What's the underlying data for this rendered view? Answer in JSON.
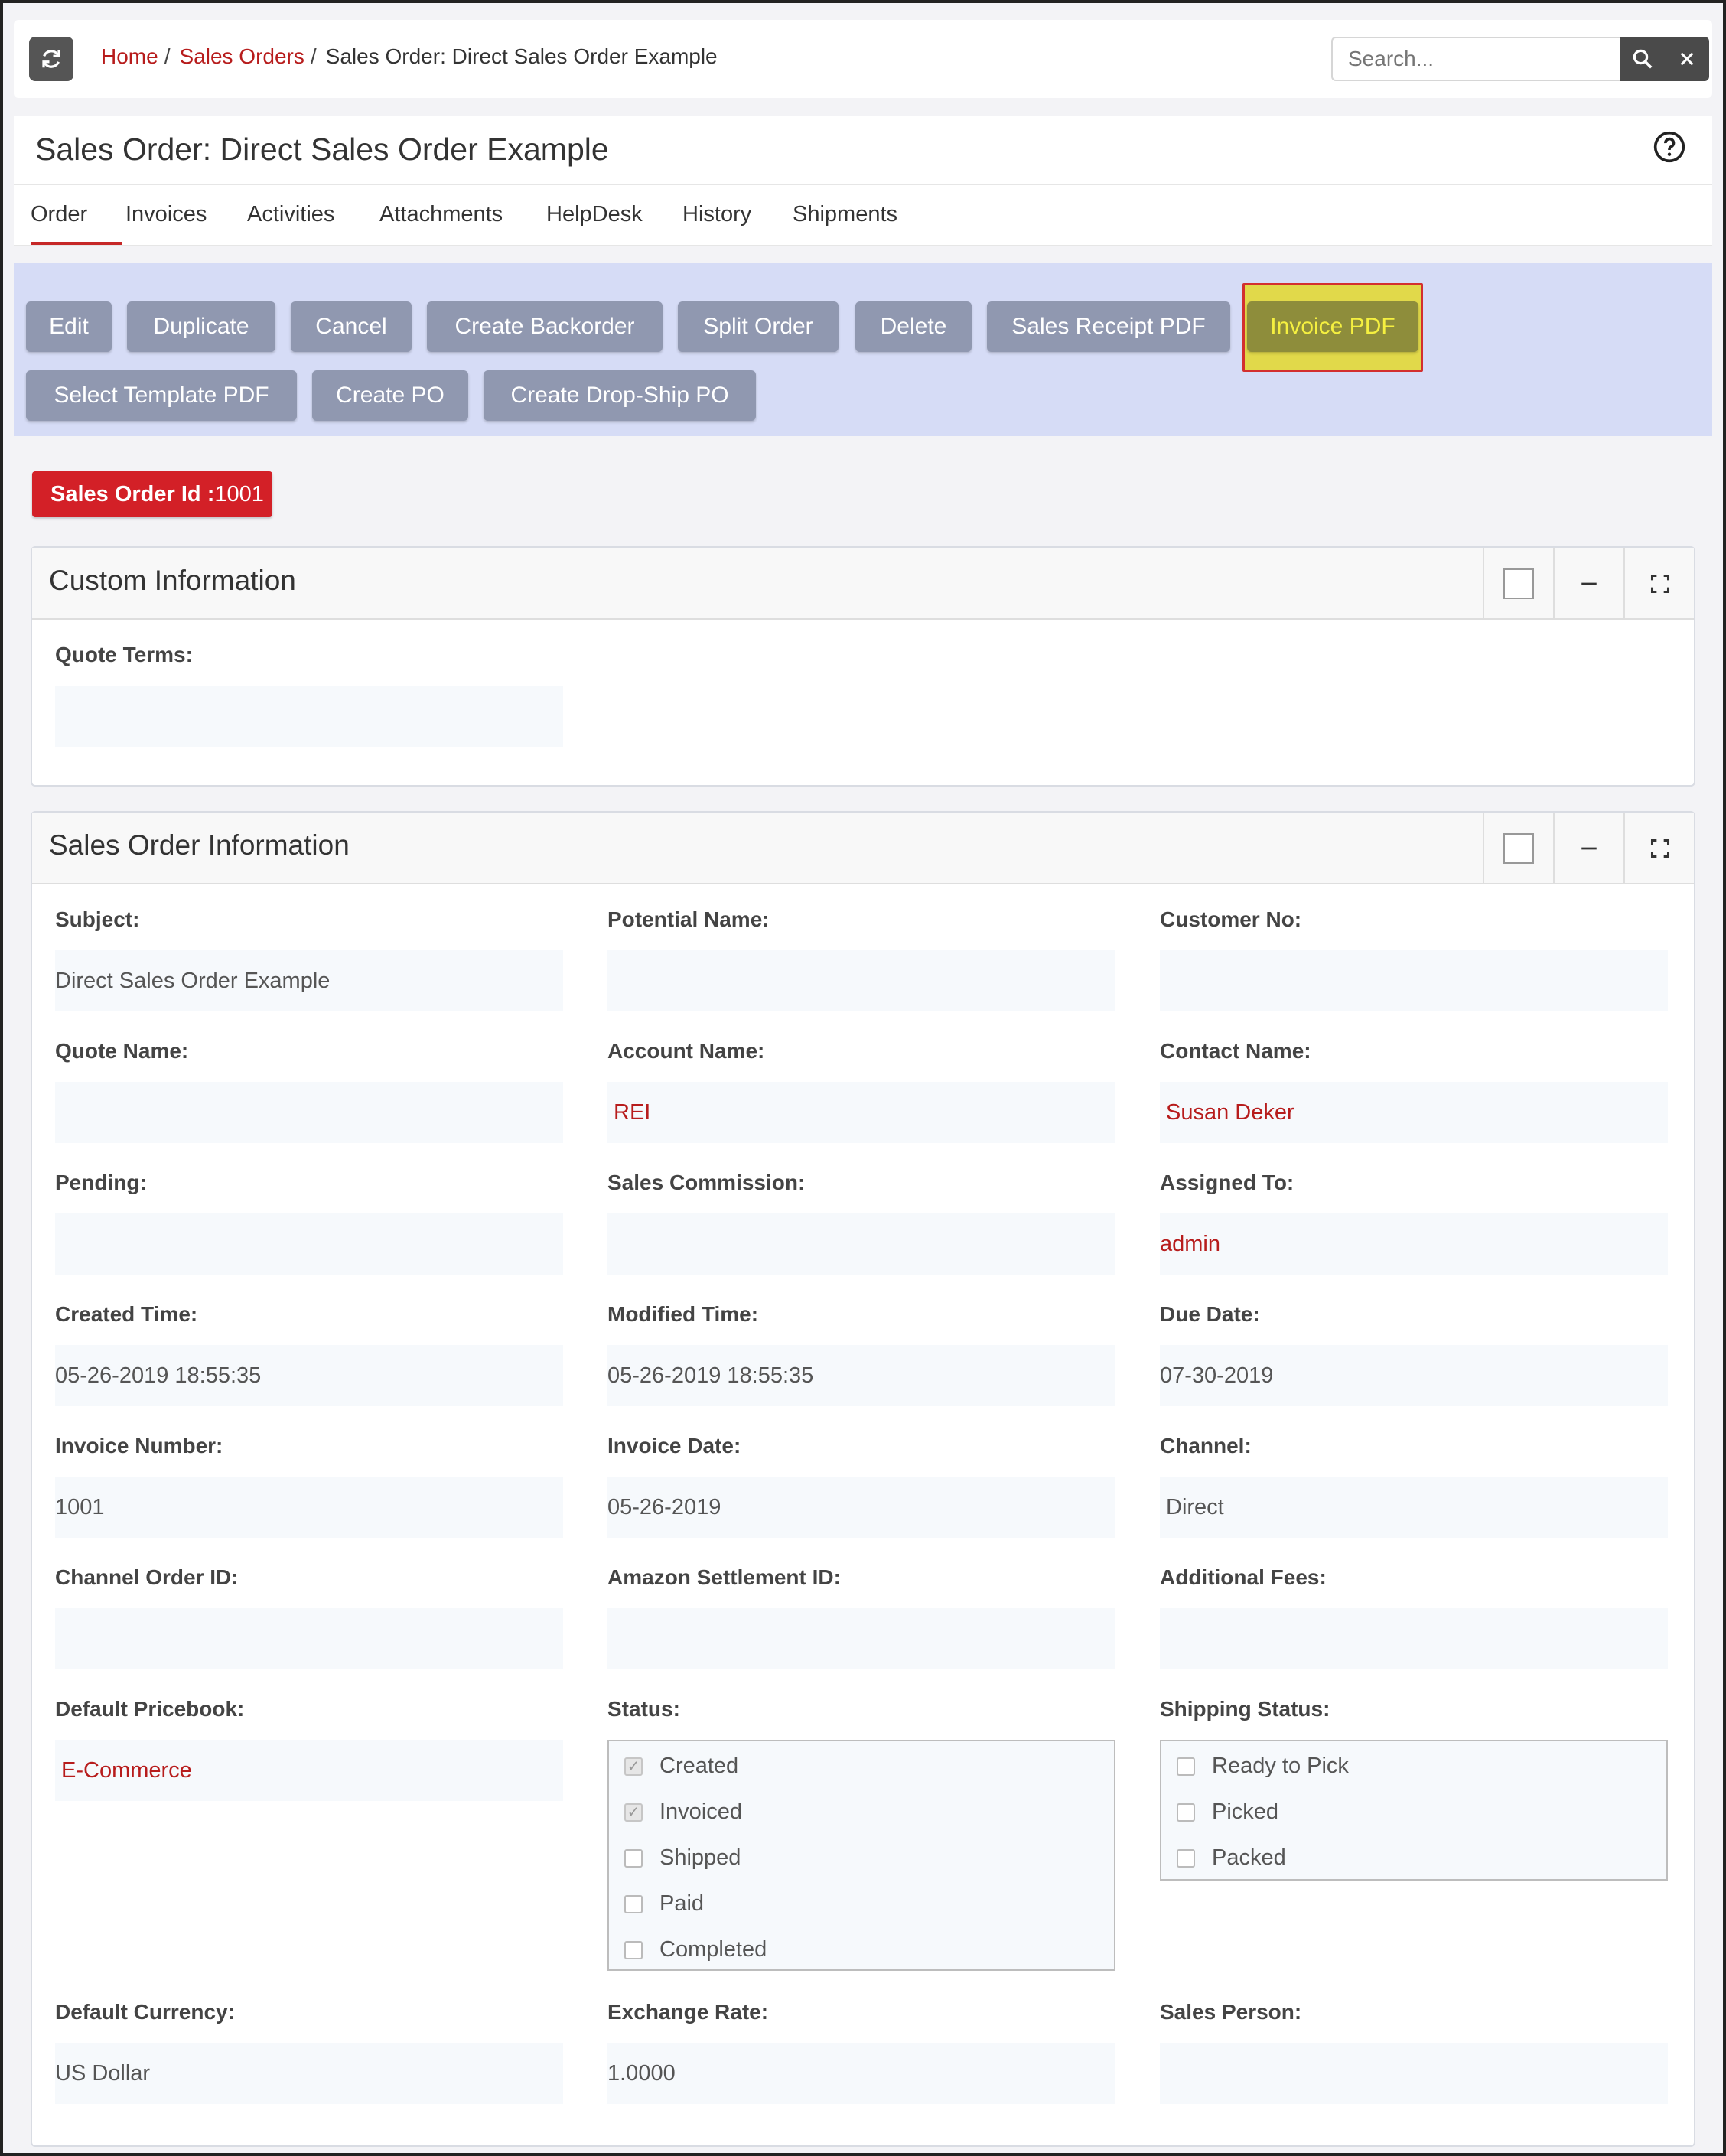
{
  "breadcrumb": {
    "home": "Home",
    "sales_orders": "Sales Orders",
    "current": "Sales Order: Direct Sales Order Example"
  },
  "search": {
    "placeholder": "Search..."
  },
  "page_title": "Sales Order: Direct Sales Order Example",
  "tabs": [
    "Order",
    "Invoices",
    "Activities",
    "Attachments",
    "HelpDesk",
    "History",
    "Shipments"
  ],
  "actions": {
    "edit": "Edit",
    "duplicate": "Duplicate",
    "cancel": "Cancel",
    "create_backorder": "Create Backorder",
    "split_order": "Split Order",
    "delete": "Delete",
    "sales_receipt_pdf": "Sales Receipt PDF",
    "invoice_pdf": "Invoice PDF",
    "select_template_pdf": "Select Template PDF",
    "create_po": "Create PO",
    "create_dropship_po": "Create Drop-Ship PO"
  },
  "badge": {
    "label": "Sales Order Id :",
    "value": "1001"
  },
  "custom_info": {
    "title": "Custom Information",
    "quote_terms_label": "Quote Terms:",
    "quote_terms_value": ""
  },
  "so_info": {
    "title": "Sales Order Information",
    "fields": {
      "subject": {
        "label": "Subject:",
        "value": "Direct Sales Order Example"
      },
      "potential_name": {
        "label": "Potential Name:",
        "value": ""
      },
      "customer_no": {
        "label": "Customer No:",
        "value": ""
      },
      "quote_name": {
        "label": "Quote Name:",
        "value": ""
      },
      "account_name": {
        "label": "Account Name:",
        "value": "REI"
      },
      "contact_name": {
        "label": "Contact Name:",
        "value": "Susan Deker"
      },
      "pending": {
        "label": "Pending:",
        "value": ""
      },
      "sales_commission": {
        "label": "Sales Commission:",
        "value": ""
      },
      "assigned_to": {
        "label": "Assigned To:",
        "value": "admin"
      },
      "created_time": {
        "label": "Created Time:",
        "value": "05-26-2019 18:55:35"
      },
      "modified_time": {
        "label": "Modified Time:",
        "value": "05-26-2019 18:55:35"
      },
      "due_date": {
        "label": "Due Date:",
        "value": "07-30-2019"
      },
      "invoice_number": {
        "label": "Invoice Number:",
        "value": "1001"
      },
      "invoice_date": {
        "label": "Invoice Date:",
        "value": "05-26-2019"
      },
      "channel": {
        "label": "Channel:",
        "value": "Direct"
      },
      "channel_order_id": {
        "label": "Channel Order ID:",
        "value": ""
      },
      "amazon_settlement_id": {
        "label": "Amazon Settlement ID:",
        "value": ""
      },
      "additional_fees": {
        "label": "Additional Fees:",
        "value": ""
      },
      "default_pricebook": {
        "label": "Default Pricebook:",
        "value": "E-Commerce"
      },
      "status": {
        "label": "Status:"
      },
      "shipping_status": {
        "label": "Shipping Status:"
      },
      "default_currency": {
        "label": "Default Currency:",
        "value": "US Dollar"
      },
      "exchange_rate": {
        "label": "Exchange Rate:",
        "value": "1.0000"
      },
      "sales_person": {
        "label": "Sales Person:",
        "value": ""
      }
    },
    "status_options": [
      {
        "label": "Created",
        "checked": true
      },
      {
        "label": "Invoiced",
        "checked": true
      },
      {
        "label": "Shipped",
        "checked": false
      },
      {
        "label": "Paid",
        "checked": false
      },
      {
        "label": "Completed",
        "checked": false
      }
    ],
    "shipping_options": [
      {
        "label": "Ready to Pick",
        "checked": false
      },
      {
        "label": "Picked",
        "checked": false
      },
      {
        "label": "Packed",
        "checked": false
      }
    ]
  },
  "colors": {
    "link": "#b71c1c",
    "badge": "#d32027",
    "toolbar_bg": "#d6dcf6",
    "button": "#9098b0",
    "highlight_button": "#8e8d3b",
    "highlight_text": "#f5f040"
  }
}
